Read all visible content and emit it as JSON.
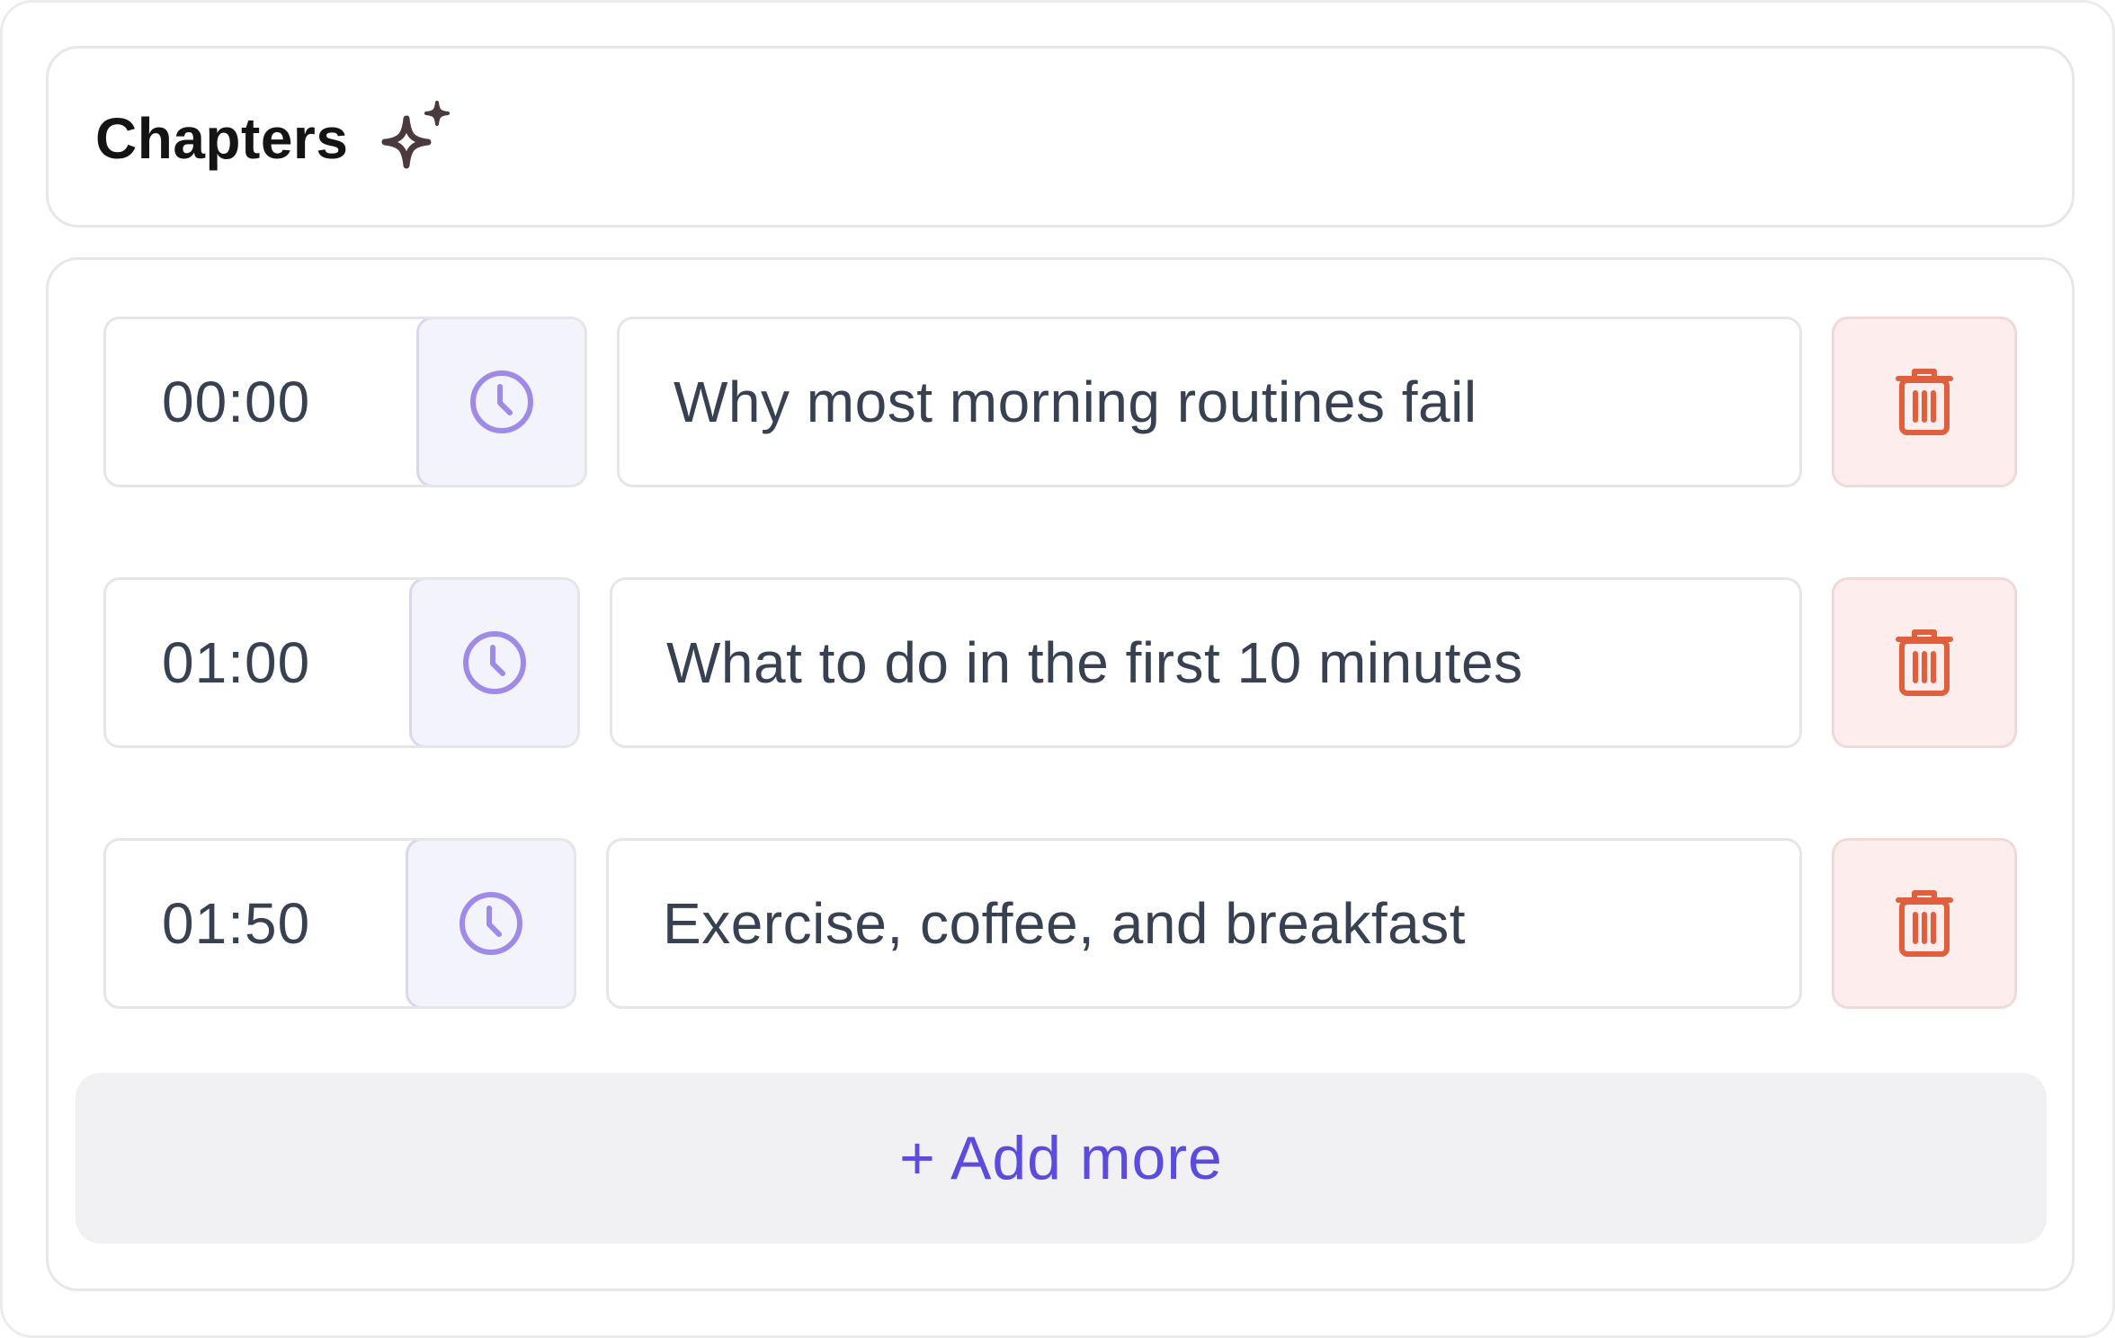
{
  "header": {
    "title": "Chapters",
    "icon": "sparkle-icon"
  },
  "chapters": [
    {
      "time": "00:00",
      "title": "Why most morning routines fail"
    },
    {
      "time": "01:00",
      "title": "What to do in the first 10 minutes"
    },
    {
      "time": "01:50",
      "title": "Exercise, coffee, and breakfast"
    }
  ],
  "actions": {
    "add_more_label": "+ Add more"
  },
  "icons": {
    "clock": "clock-icon",
    "delete": "trash-icon"
  },
  "colors": {
    "accent": "#5b4bdf",
    "clock_icon": "#a08ae8",
    "clock_bg": "#f3f3fc",
    "delete_icon": "#e0603e",
    "delete_bg": "#fdeeed",
    "text": "#374151"
  }
}
